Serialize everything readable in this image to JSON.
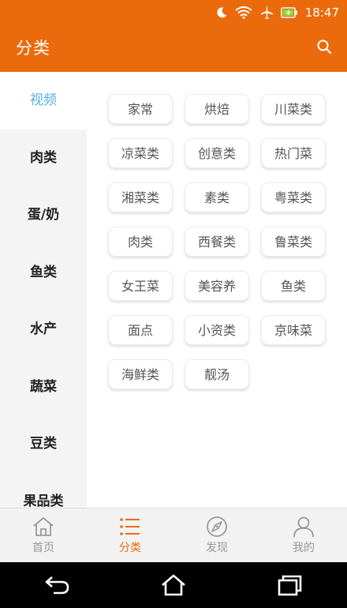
{
  "status_bar": {
    "time": "18:47",
    "icons": [
      "moon-icon",
      "wifi-icon",
      "airplane-icon",
      "battery-charging-icon"
    ]
  },
  "app_bar": {
    "title": "分类",
    "search_icon": "search-icon"
  },
  "sidebar": {
    "items": [
      {
        "label": "视频",
        "active": true
      },
      {
        "label": "肉类"
      },
      {
        "label": "蛋/奶"
      },
      {
        "label": "鱼类"
      },
      {
        "label": "水产"
      },
      {
        "label": "蔬菜"
      },
      {
        "label": "豆类"
      },
      {
        "label": "果品类"
      }
    ]
  },
  "categories": [
    "家常",
    "烘焙",
    "川菜类",
    "凉菜类",
    "创意类",
    "热门菜",
    "湘菜类",
    "素类",
    "粤菜类",
    "肉类",
    "西餐类",
    "鲁菜类",
    "女王菜",
    "美容养",
    "鱼类",
    "面点",
    "小资类",
    "京味菜",
    "海鲜类",
    "靓汤"
  ],
  "tabs": [
    {
      "label": "首页",
      "icon": "home-icon"
    },
    {
      "label": "分类",
      "icon": "list-icon",
      "active": true
    },
    {
      "label": "发现",
      "icon": "compass-icon"
    },
    {
      "label": "我的",
      "icon": "person-icon"
    }
  ],
  "nav_bar": {
    "icons": [
      "back-icon",
      "home-nav-icon",
      "recent-apps-icon"
    ]
  },
  "colors": {
    "accent": "#ea6a0c",
    "sidebar_active_text": "#5aaee0",
    "sidebar_bg": "#f4f4f4"
  }
}
